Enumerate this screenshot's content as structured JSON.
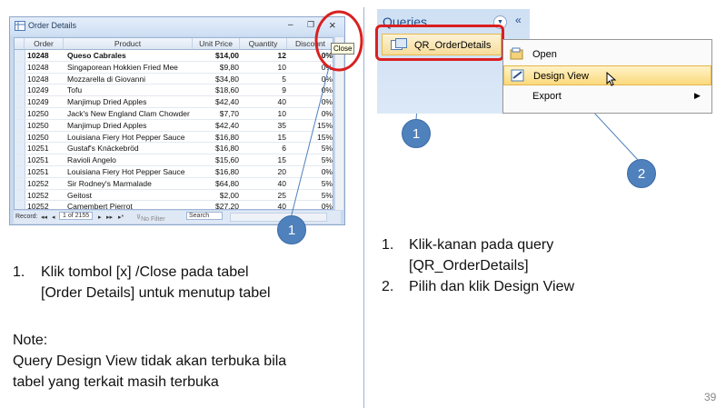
{
  "left_window": {
    "title": "Order Details",
    "columns": [
      "Order",
      "Product",
      "Unit Price",
      "Quantity",
      "Discount"
    ],
    "rows": [
      [
        "10248",
        "Queso Cabrales",
        "$14,00",
        "12",
        "0%"
      ],
      [
        "10248",
        "Singaporean Hokkien Fried Mee",
        "$9,80",
        "10",
        "0%"
      ],
      [
        "10248",
        "Mozzarella di Giovanni",
        "$34,80",
        "5",
        "0%"
      ],
      [
        "10249",
        "Tofu",
        "$18,60",
        "9",
        "0%"
      ],
      [
        "10249",
        "Manjimup Dried Apples",
        "$42,40",
        "40",
        "0%"
      ],
      [
        "10250",
        "Jack's New England Clam Chowder",
        "$7,70",
        "10",
        "0%"
      ],
      [
        "10250",
        "Manjimup Dried Apples",
        "$42,40",
        "35",
        "15%"
      ],
      [
        "10250",
        "Louisiana Fiery Hot Pepper Sauce",
        "$16,80",
        "15",
        "15%"
      ],
      [
        "10251",
        "Gustaf's Knäckebröd",
        "$16,80",
        "6",
        "5%"
      ],
      [
        "10251",
        "Ravioli Angelo",
        "$15,60",
        "15",
        "5%"
      ],
      [
        "10251",
        "Louisiana Fiery Hot Pepper Sauce",
        "$16,80",
        "20",
        "0%"
      ],
      [
        "10252",
        "Sir Rodney's Marmalade",
        "$64,80",
        "40",
        "5%"
      ],
      [
        "10252",
        "Geitost",
        "$2,00",
        "25",
        "5%"
      ],
      [
        "10252",
        "Camembert Pierrot",
        "$27,20",
        "40",
        "0%"
      ]
    ],
    "close_tooltip": "Close",
    "close_glyph": "×",
    "nav": {
      "record_label": "Record:",
      "position": "1 of 2155",
      "filter": "No Filter",
      "search": "Search"
    }
  },
  "right_panel": {
    "header": "Queries",
    "query_item": "QR_OrderDetails",
    "menu": [
      {
        "label": "Open",
        "icon": "open-icon",
        "highlighted": false
      },
      {
        "label": "Design View",
        "icon": "design-view-icon",
        "highlighted": true
      },
      {
        "label": "Export",
        "icon": "",
        "highlighted": false
      }
    ]
  },
  "callouts": {
    "left": "1",
    "right_1": "1",
    "right_2": "2"
  },
  "instructions_left": {
    "step1_num": "1.",
    "step1_line1": "Klik tombol [x] /Close pada tabel",
    "step1_line2": "[Order Details] untuk menutup tabel",
    "note_title": "Note:",
    "note_line1": "Query Design View tidak akan terbuka bila",
    "note_line2": "tabel yang terkait masih terbuka"
  },
  "instructions_right": {
    "step1_num": "1.",
    "step1_line1": "Klik-kanan pada query",
    "step1_line2": "[QR_OrderDetails]",
    "step2_num": "2.",
    "step2_line1": "Pilih dan klik Design View"
  },
  "page_number": "39",
  "colors": {
    "callout_fill": "#4f81bd",
    "highlight_red": "#d92020",
    "access_blue": "#c9d9ee"
  }
}
